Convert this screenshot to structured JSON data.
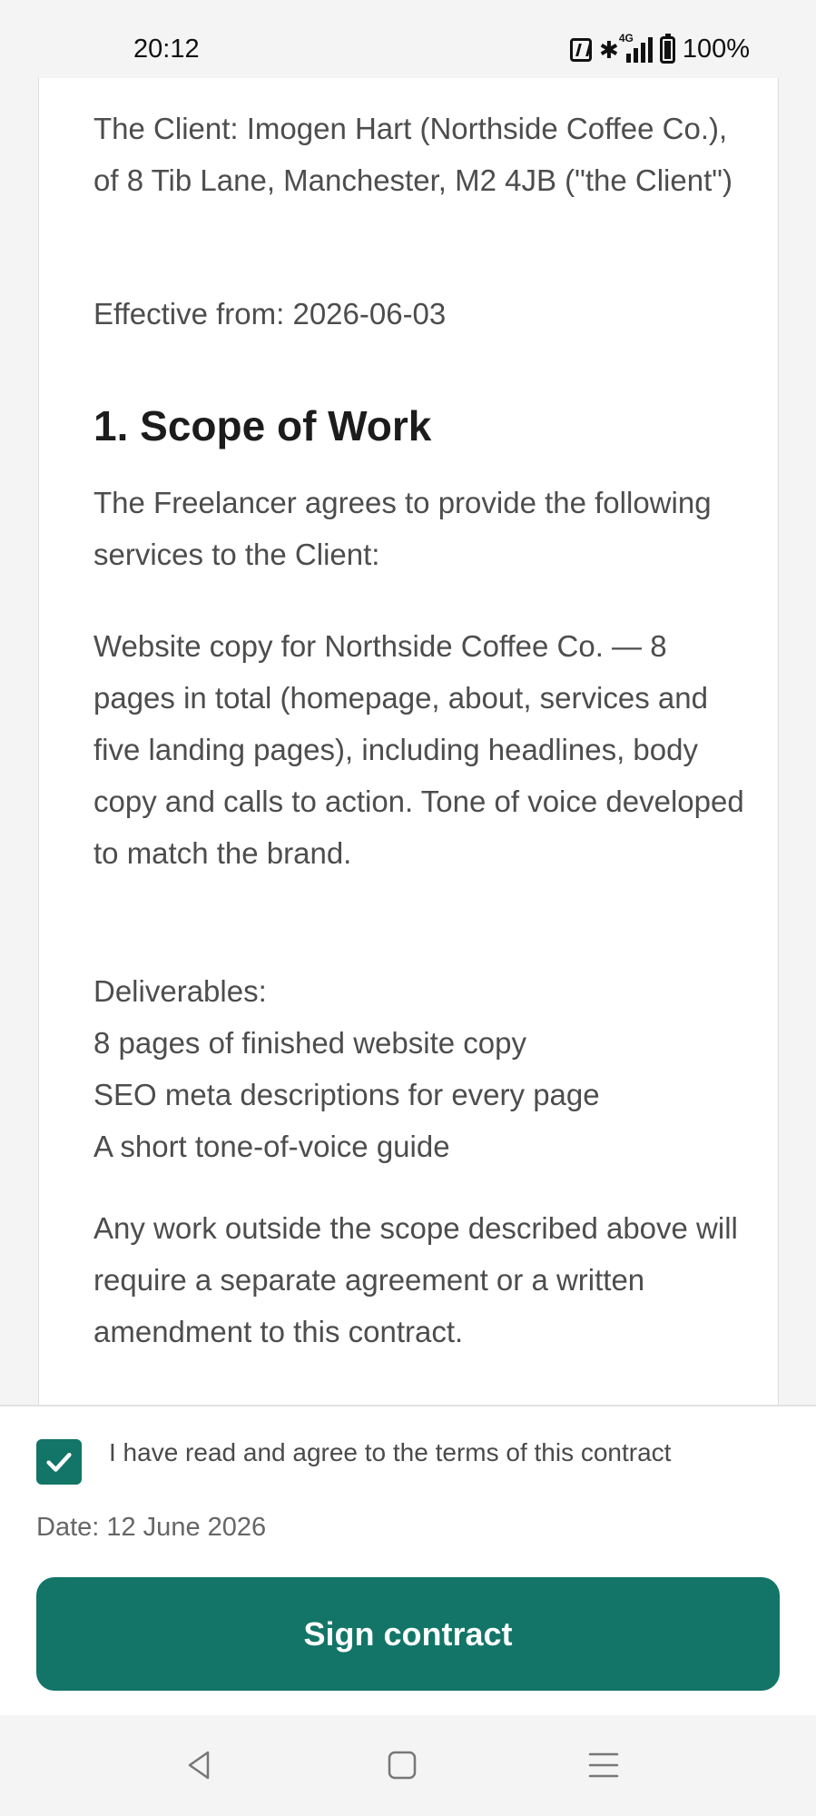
{
  "status_bar": {
    "time": "20:12",
    "network": "4G",
    "battery": "100%"
  },
  "document": {
    "client_line": "The Client: Imogen Hart (Northside Coffee Co.), of 8 Tib Lane, Manchester, M2 4JB (\"the Client\")",
    "effective_from": "Effective from: 2026-06-03",
    "section_heading": "1. Scope of Work",
    "intro": "The Freelancer agrees to provide the following services to the Client:",
    "description": "Website copy for Northside Coffee Co. — 8 pages in total (homepage, about, services and five landing pages), including headlines, body copy and calls to action. Tone of voice developed to match the brand.",
    "deliverables_title": "Deliverables:",
    "deliverables": [
      "8 pages of finished website copy",
      "SEO meta descriptions for every page",
      "A short tone-of-voice guide"
    ],
    "outside_scope": "Any work outside the scope described above will require a separate agreement or a written amendment to this contract."
  },
  "agreement": {
    "checked": true,
    "checkbox_label": "I have read and agree to the terms of this contract",
    "date": "Date: 12 June 2026",
    "sign_button": "Sign contract"
  },
  "colors": {
    "accent": "#127567",
    "page_background": "#f4f4f4",
    "text": "#4d4d4d",
    "heading": "#1c1c1c"
  },
  "icons": {
    "nav_back": "back-triangle-icon",
    "nav_home": "home-square-icon",
    "nav_menu": "menu-lines-icon",
    "check": "checkmark-icon"
  }
}
